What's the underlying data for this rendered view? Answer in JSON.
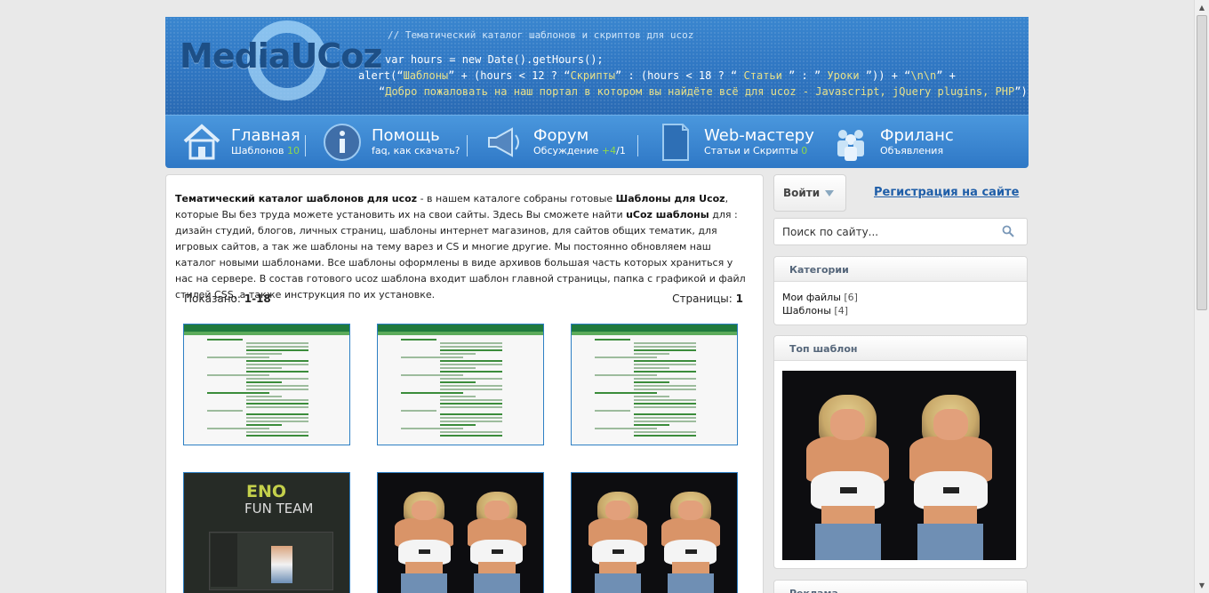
{
  "header": {
    "logo": "MediaUCoz",
    "code_comment": "// Тематический каталог шаблонов и скриптов для ucoz",
    "code_line1": "var hours = new Date().getHours();",
    "code_line2_a": "alert(“",
    "code_line2_b": "Шаблоны",
    "code_line2_c": "” + (hours < 12 ? “",
    "code_line2_d": "Скрипты",
    "code_line2_e": "” : (hours  < 18 ? “   ",
    "code_line2_f": "Статьи",
    "code_line2_g": "  ” : ”  ",
    "code_line2_h": "Уроки",
    "code_line2_i": " ”)) + “",
    "code_line2_j": "\\n\\n",
    "code_line2_k": "” +",
    "code_line3_a": "“",
    "code_line3_b": "Добро пожаловать на наш портал в котором вы найдёте всё для ucoz - Javascript, jQuery plugins, PHP",
    "code_line3_c": "”);"
  },
  "nav": [
    {
      "title": "Главная",
      "sub": "Шаблонов ",
      "badge": "10",
      "tail": ""
    },
    {
      "title": "Помощь",
      "sub": "faq, как скачать?",
      "badge": "",
      "tail": ""
    },
    {
      "title": "Форум",
      "sub": "Обсуждение ",
      "badge": "+4",
      "tail": "/1"
    },
    {
      "title": "Web-мастеру",
      "sub": "Статьи и Скрипты ",
      "badge": "0",
      "tail": ""
    },
    {
      "title": "Фриланс",
      "sub": "Объявления",
      "badge": "",
      "tail": ""
    }
  ],
  "main": {
    "intro_b1": "Тематический каталог шаблонов для ucoz",
    "intro_t1": " - в нашем каталоге собраны готовые ",
    "intro_b2": "Шаблоны для Ucoz",
    "intro_t2": ", которые Вы  без труда можете установить их на свои сайты. Здесь Вы сможете найти ",
    "intro_b3": "uCoz шаблоны",
    "intro_t3": " для : дизайн студий,  блогов, личных страниц, шаблоны интернет магазинов, для сайтов общих тематик, для игровых сайтов, а так же  шаблоны на тему варез и CS и многие другие. Мы постоянно обновляем наш каталог новыми шаблонами. Все  шаблоны оформлены в виде архивов большая часть которых храниться у нас на сервере. В состав готового ucoz  шаблона входит шаблон главной страницы, папка с графикой и файл стилей CSS, а также инструкция по их  установке.",
    "shown_label": "Показано: ",
    "shown_value": "1-18",
    "pages_label": "Страницы: ",
    "pages_value": "1",
    "thumb_dark_brand": "ENO",
    "thumb_dark_brand2": "FUN TEAM"
  },
  "sidebar": {
    "login": "Войти",
    "register": "Регистрация на сайте",
    "search_placeholder": "Поиск по сайту...",
    "categories_title": "Категории",
    "categories": [
      {
        "name": "Мои файлы",
        "count": " [6]"
      },
      {
        "name": "Шаблоны",
        "count": " [4]"
      }
    ],
    "top_title": "Топ шаблон",
    "ads_title": "Реклама"
  }
}
